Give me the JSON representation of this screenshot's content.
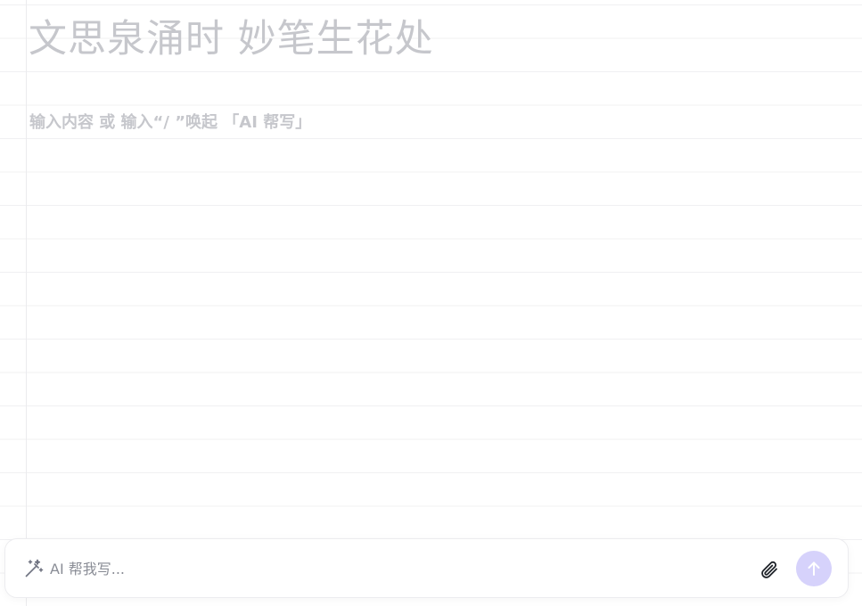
{
  "editor": {
    "title_placeholder": "文思泉涌时 妙笔生花处",
    "body_placeholder": "输入内容 或 输入“/ ”唤起 「AI 帮写」"
  },
  "ai_bar": {
    "input_placeholder": "AI 帮我写...",
    "icons": {
      "left": "magic-wand-icon",
      "attach": "paperclip-icon",
      "send": "arrow-up-icon"
    },
    "send_button_color": "#d6d2fb"
  }
}
